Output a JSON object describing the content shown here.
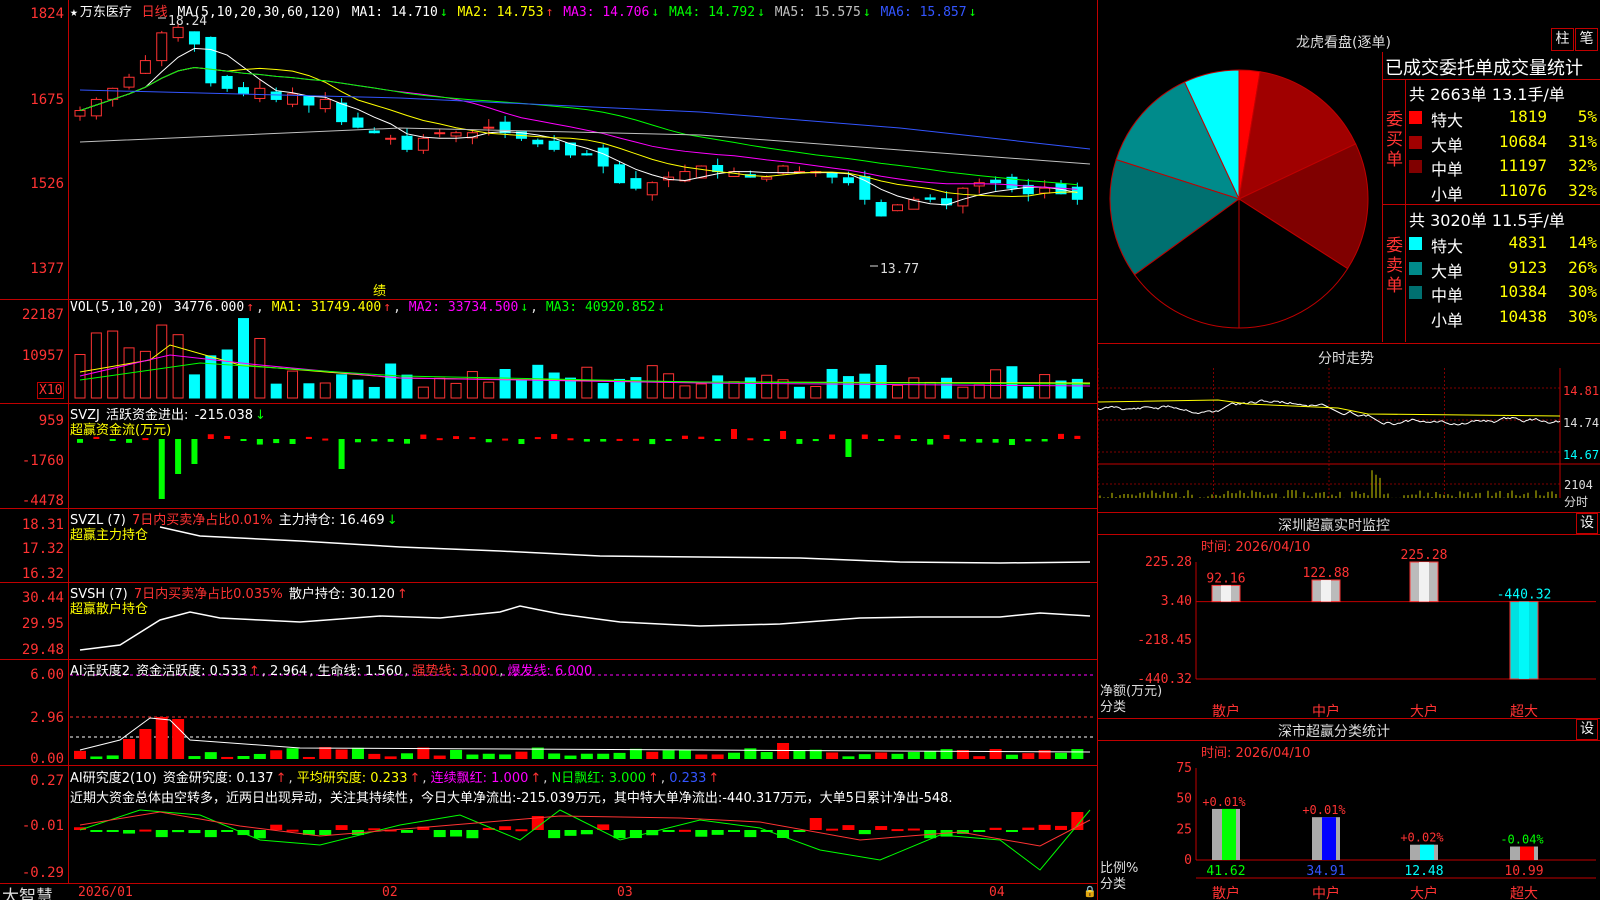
{
  "kline": {
    "title": "万东医疗",
    "period": "日线",
    "ma_label": "MA(5,10,20,30,60,120)",
    "ma": [
      {
        "name": "MA1:",
        "value": "14.710",
        "arrow": "↓",
        "color": "#ffffff"
      },
      {
        "name": "MA2:",
        "value": "14.753",
        "arrow": "↑",
        "color": "#ffff00"
      },
      {
        "name": "MA3:",
        "value": "14.706",
        "arrow": "↓",
        "color": "#ff00ff"
      },
      {
        "name": "MA4:",
        "value": "14.792",
        "arrow": "↓",
        "color": "#00ff00"
      },
      {
        "name": "MA5:",
        "value": "15.575",
        "arrow": "↓",
        "color": "#c0c0c0"
      },
      {
        "name": "MA6:",
        "value": "15.857",
        "arrow": "↓",
        "color": "#3355ff"
      }
    ],
    "yticks": [
      "1824",
      "1675",
      "1526",
      "1377"
    ],
    "high_label": "18.24",
    "low_label": "13.77",
    "marker": "绩"
  },
  "vol": {
    "label": "VOL(5,10,20)",
    "value": "34776.000",
    "arrow": "↑",
    "ma": [
      {
        "name": "MA1:",
        "value": "31749.400",
        "arrow": "↑",
        "color": "#ffff00"
      },
      {
        "name": "MA2:",
        "value": "33734.500",
        "arrow": "↓",
        "color": "#ff00ff"
      },
      {
        "name": "MA3:",
        "value": "40920.852",
        "arrow": "↓",
        "color": "#00ff00"
      }
    ],
    "yticks": [
      "22187",
      "10957"
    ],
    "unit": "X10"
  },
  "svzj": {
    "name": "SVZJ",
    "title": "活跃资金进出:",
    "value": "-215.038",
    "arrow": "↓",
    "sub": "超赢资金流(万元)",
    "yticks": [
      "959",
      "-1760",
      "-4478"
    ]
  },
  "svzl": {
    "name": "SVZL (7)",
    "text1": "7日内买卖净占比0.01%",
    "text2": "主力持仓: 16.469",
    "arrow": "↓",
    "sub": "超赢主力持仓",
    "yticks": [
      "18.31",
      "17.32",
      "16.32"
    ]
  },
  "svsh": {
    "name": "SVSH (7)",
    "text1": "7日内买卖净占比0.035%",
    "text2": "散户持仓: 30.120",
    "arrow": "↑",
    "sub": "超赢散户持仓",
    "yticks": [
      "30.44",
      "29.95",
      "29.48"
    ]
  },
  "ai_active": {
    "name": "AI活跃度2",
    "t1": "资金活跃度: 0.533",
    "t2": "2.964",
    "t3": "生命线: 1.560",
    "t4": "强势线: 3.000",
    "t5": "爆发线: 6.000",
    "yticks": [
      "6.00",
      "2.96",
      "0.00"
    ]
  },
  "ai_research": {
    "name": "AI研究度2(10)",
    "t1": "资金研究度: 0.137",
    "t2": "平均研究度: 0.233",
    "t3": "连续飘红: 1.000",
    "t4": "N日飘红: 3.000",
    "t5": "0.233",
    "comment": "近期大资金总体由空转多，近两日出现异动，关注其持续性，今日大单净流出:-215.039万元，其中特大单净流出:-440.317万元，大单5日累计净出-548.",
    "yticks": [
      "0.27",
      "-0.01",
      "-0.29"
    ]
  },
  "bottom": {
    "brand": "大智慧",
    "dates": [
      "2026/01",
      "02",
      "03",
      "04"
    ]
  },
  "dragon": {
    "title": "龙虎看盘(逐单)",
    "btn1": "柱",
    "btn2": "笔",
    "stat_title": "已成交委托单成交量统计",
    "buy_side": "委买单",
    "sell_side": "委卖单",
    "buy_header": "共 2663单 13.1手/单",
    "sell_header": "共 3020单 11.5手/单",
    "buy_rows": [
      {
        "label": "特大",
        "count": "1819",
        "pct": "5%",
        "color": "#ff0000"
      },
      {
        "label": "大单",
        "count": "10684",
        "pct": "31%",
        "color": "#a00000"
      },
      {
        "label": "中单",
        "count": "11197",
        "pct": "32%",
        "color": "#800000"
      },
      {
        "label": "小单",
        "count": "11076",
        "pct": "32%",
        "color": "#000000"
      }
    ],
    "sell_rows": [
      {
        "label": "特大",
        "count": "4831",
        "pct": "14%",
        "color": "#00ffff"
      },
      {
        "label": "大单",
        "count": "9123",
        "pct": "26%",
        "color": "#008b8b"
      },
      {
        "label": "中单",
        "count": "10384",
        "pct": "30%",
        "color": "#007070"
      },
      {
        "label": "小单",
        "count": "10438",
        "pct": "30%",
        "color": "#000000"
      }
    ]
  },
  "intraday": {
    "title": "分时走势",
    "yticks": [
      "14.81",
      "14.74",
      "14.67"
    ],
    "vol_label": "2104",
    "vol_unit": "分时"
  },
  "monitor": {
    "title": "深圳超赢实时监控",
    "btn": "设",
    "time": "时间: 2026/04/10",
    "yticks": [
      "225.28",
      "3.40",
      "-218.45",
      "-440.32"
    ],
    "ylabel": "净额(万元)",
    "xlabel": "分类",
    "cats": [
      "散户",
      "中户",
      "大户",
      "超大"
    ],
    "values": [
      "92.16",
      "122.88",
      "225.28",
      "-440.32"
    ]
  },
  "classify": {
    "title": "深市超赢分类统计",
    "btn": "设",
    "time": "时间: 2026/04/10",
    "yticks": [
      "75",
      "50",
      "25",
      "0"
    ],
    "ylabel": "比例%",
    "xlabel": "分类",
    "cats": [
      "散户",
      "中户",
      "大户",
      "超大"
    ],
    "top_labels": [
      "+0.01%",
      "+0.01%",
      "+0.02%",
      "-0.04%"
    ],
    "bottom_values": [
      "41.62",
      "34.91",
      "12.48",
      "10.99"
    ]
  },
  "chart_data": [
    {
      "type": "pie",
      "title": "龙虎看盘(逐单)",
      "categories": [
        "买特大",
        "买大单",
        "买中单",
        "买小单",
        "卖特大",
        "卖大单",
        "卖中单",
        "卖小单"
      ],
      "values": [
        1819,
        10684,
        11197,
        11076,
        4831,
        9123,
        10384,
        10438
      ]
    },
    {
      "type": "bar",
      "title": "深圳超赢实时监控",
      "categories": [
        "散户",
        "中户",
        "大户",
        "超大"
      ],
      "values": [
        92.16,
        122.88,
        225.28,
        -440.32
      ],
      "ylabel": "净额(万元)",
      "xlabel": "分类",
      "ylim": [
        -440.32,
        225.28
      ]
    },
    {
      "type": "bar",
      "title": "深市超赢分类统计",
      "categories": [
        "散户",
        "中户",
        "大户",
        "超大"
      ],
      "values": [
        41.62,
        34.91,
        12.48,
        10.99
      ],
      "ylabel": "比例%",
      "xlabel": "分类",
      "ylim": [
        0,
        75
      ]
    }
  ]
}
